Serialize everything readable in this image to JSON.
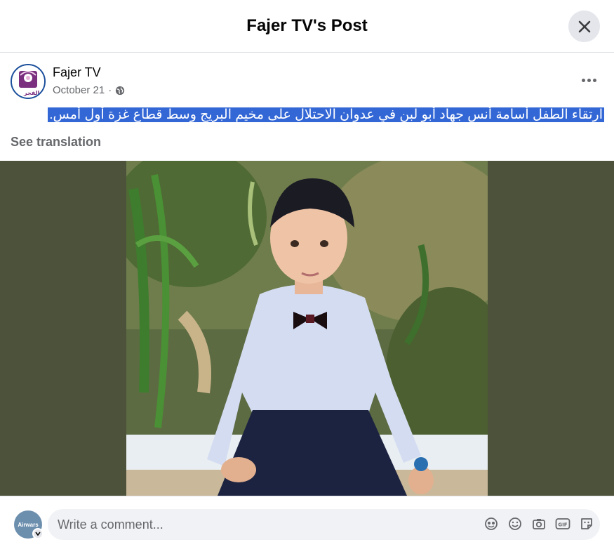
{
  "header": {
    "title": "Fajer TV's Post"
  },
  "post": {
    "page_name": "Fajer TV",
    "date": "October 21",
    "separator": "·",
    "text": "ارتقاء الطفل أسامة أنس جهاد أبو لبن في عدوان الاحتلال على مخيم البريج وسط قطاع غزة أول أمس.",
    "see_translation": "See translation",
    "logo_text": "الفجر"
  },
  "comment": {
    "placeholder": "Write a comment...",
    "avatar_text": "Airwars"
  },
  "icons": {
    "close": "close-icon",
    "globe": "globe-icon",
    "more": "more-horizontal-icon",
    "comment_icons": [
      "avatar-sticker-icon",
      "emoji-icon",
      "camera-icon",
      "gif-icon",
      "sticker-icon"
    ]
  },
  "colors": {
    "highlight": "#3367d6",
    "media_bg": "#4d523a",
    "secondary_text": "#65676b"
  }
}
